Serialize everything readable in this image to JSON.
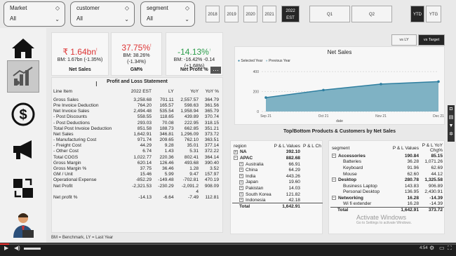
{
  "filters": [
    {
      "label": "Market",
      "value": "All"
    },
    {
      "label": "customer",
      "value": "All"
    },
    {
      "label": "segment",
      "value": "All"
    }
  ],
  "years": [
    "2018",
    "2019",
    "2020",
    "2021"
  ],
  "active_year": {
    "year": "2022",
    "tag": "EST"
  },
  "quarters": [
    "Q1",
    "Q2"
  ],
  "period": {
    "ytd": "YTD",
    "ytg": "YTG"
  },
  "compare": {
    "vs_ly": "vs LY",
    "vs_target": "vs Target"
  },
  "kpis": {
    "net_sales": {
      "value": "₹ 1.64bn",
      "flag": "!",
      "sub": "BM: 1.67bn (-1.35%)",
      "label": "Net Sales"
    },
    "gm": {
      "value": "37.75%",
      "flag": "!",
      "sub1": "BM: 38.26%",
      "sub2": "(-1.34%)",
      "label": "GM%"
    },
    "np": {
      "value": "-14.13%",
      "flag": "↑",
      "sub": "BM: -16.42%",
      "sub_val": "-0.14 (+1.68%)",
      "label": "Net Profit %",
      "menu": "···"
    }
  },
  "pl": {
    "title": "Profit and Loss Statement",
    "headers": [
      "Line Item",
      "2022 EST",
      "LY",
      "YoY",
      "YoY %"
    ],
    "rows": [
      [
        "Gross Sales",
        "3,258.68",
        "701.11",
        "2,557.57",
        "364.79"
      ],
      [
        "Pre Invoice Deduction",
        "764.20",
        "165.57",
        "598.63",
        "361.56"
      ],
      [
        "Net Invoice Sales",
        "2,494.48",
        "535.54",
        "1,958.94",
        "365.79"
      ],
      [
        "- Post Discounts",
        "558.55",
        "118.65",
        "439.89",
        "370.74"
      ],
      [
        "- Post Deductions",
        "293.03",
        "70.08",
        "222.95",
        "318.15"
      ],
      [
        "Total Post Invoice Deduction",
        "851.58",
        "188.73",
        "662.85",
        "351.21"
      ],
      [
        "Net Sales",
        "1,642.91",
        "346.81",
        "1,296.09",
        "373.72"
      ],
      [
        "- Manufacturing Cost",
        "971.74",
        "209.65",
        "762.10",
        "363.51"
      ],
      [
        "- Freight Cost",
        "44.29",
        "9.28",
        "35.01",
        "377.14"
      ],
      [
        "- Other Cost",
        "6.74",
        "1.43",
        "5.31",
        "372.22"
      ],
      [
        "Total COGS",
        "1,022.77",
        "220.36",
        "802.41",
        "364.14"
      ],
      [
        "Gross Margin",
        "620.14",
        "126.46",
        "493.68",
        "390.40"
      ],
      [
        "Gross Margin %",
        "37.75",
        "36.46",
        "1.28",
        "3.52"
      ],
      [
        "GM / Unit",
        "15.46",
        "5.99",
        "9.47",
        "157.97"
      ],
      [
        "Operational Expense",
        "-852.29",
        "-149.48",
        "-702.81",
        "470.19"
      ],
      [
        "Net Profit",
        "-2,321.53",
        "-230.29",
        "-2,091.2",
        "908.09"
      ],
      [
        "",
        "",
        "",
        "4",
        ""
      ],
      [
        "Net profit %",
        "-14.13",
        "-6.64",
        "-7.49",
        "112.81"
      ]
    ]
  },
  "net_sales_chart": {
    "title": "Net Sales",
    "legend": [
      "Selected Year",
      "Previous Year"
    ],
    "xlabel": "date"
  },
  "chart_data": {
    "type": "area",
    "title": "Net Sales",
    "x": [
      "Sep 21",
      "Oct 21",
      "Nov 21",
      "Dec 21"
    ],
    "series": [
      {
        "name": "Selected Year",
        "values": [
          140,
          215,
          275,
          300
        ]
      },
      {
        "name": "Previous Year",
        "values": [
          null,
          null,
          null,
          null
        ]
      }
    ],
    "ylim": [
      0,
      450
    ],
    "yticks": [
      0,
      200,
      400
    ],
    "xlabel": "date",
    "legend": "top-left",
    "colors": {
      "selected": "#7fb2c4",
      "line": "#2f7fa0"
    }
  },
  "topbottom": {
    "title": "Top/Bottom Products & Customers by Net Sales",
    "region": {
      "headers": [
        "region",
        "P & L Values",
        "P & L Ch"
      ],
      "rows": [
        {
          "name": "NA",
          "value": "392.10",
          "level": 0,
          "bold": true,
          "exp": "+"
        },
        {
          "name": "APAC",
          "value": "882.68",
          "level": 0,
          "bold": true,
          "exp": "−"
        },
        {
          "name": "Australia",
          "value": "66.91",
          "level": 1,
          "bold": false,
          "exp": "+"
        },
        {
          "name": "China",
          "value": "64.29",
          "level": 1,
          "bold": false,
          "exp": "+"
        },
        {
          "name": "India",
          "value": "443.26",
          "level": 1,
          "bold": false,
          "exp": "+"
        },
        {
          "name": "Japan",
          "value": "19.60",
          "level": 1,
          "bold": false,
          "exp": "+"
        },
        {
          "name": "Pakistan",
          "value": "14.03",
          "level": 1,
          "bold": false,
          "exp": "+"
        },
        {
          "name": "South Korea",
          "value": "121.82",
          "level": 1,
          "bold": false,
          "exp": "+"
        },
        {
          "name": "Indonesia",
          "value": "42.18",
          "level": 1,
          "bold": false,
          "exp": "+"
        }
      ],
      "total_label": "Total",
      "total_value": "1,642.91"
    },
    "segment": {
      "headers": [
        "segment",
        "P & L Values",
        "P & L YoY Chg%"
      ],
      "rows": [
        {
          "name": "Accessories",
          "value": "190.84",
          "chg": "85.15",
          "level": 0,
          "bold": true,
          "exp": "−"
        },
        {
          "name": "Batteries",
          "value": "36.28",
          "chg": "1,071.26",
          "level": 1,
          "bold": false,
          "exp": ""
        },
        {
          "name": "Keyboard",
          "value": "91.96",
          "chg": "62.69",
          "level": 1,
          "bold": false,
          "exp": ""
        },
        {
          "name": "Mouse",
          "value": "62.60",
          "chg": "44.12",
          "level": 1,
          "bold": false,
          "exp": ""
        },
        {
          "name": "Desktop",
          "value": "280.78",
          "chg": "1,325.58",
          "level": 0,
          "bold": true,
          "exp": "−"
        },
        {
          "name": "Business Laptop",
          "value": "143.83",
          "chg": "906.89",
          "level": 1,
          "bold": false,
          "exp": ""
        },
        {
          "name": "Personal Desktop",
          "value": "136.95",
          "chg": "2,430.91",
          "level": 1,
          "bold": false,
          "exp": ""
        },
        {
          "name": "Networking",
          "value": "16.28",
          "chg": "-14.39",
          "level": 0,
          "bold": true,
          "exp": "−"
        },
        {
          "name": "Wi fi extender",
          "value": "16.28",
          "chg": "-14.39",
          "level": 1,
          "bold": false,
          "exp": ""
        }
      ],
      "total_label": "Total",
      "total_value": "1,642.91",
      "total_chg": "373.72"
    }
  },
  "footer_note": "BM = Benchmark, LY = Last Year",
  "watermark": {
    "line1": "Activate Windows",
    "line2": "Go to Settings to activate Windows."
  },
  "video": {
    "time": "4:54"
  }
}
